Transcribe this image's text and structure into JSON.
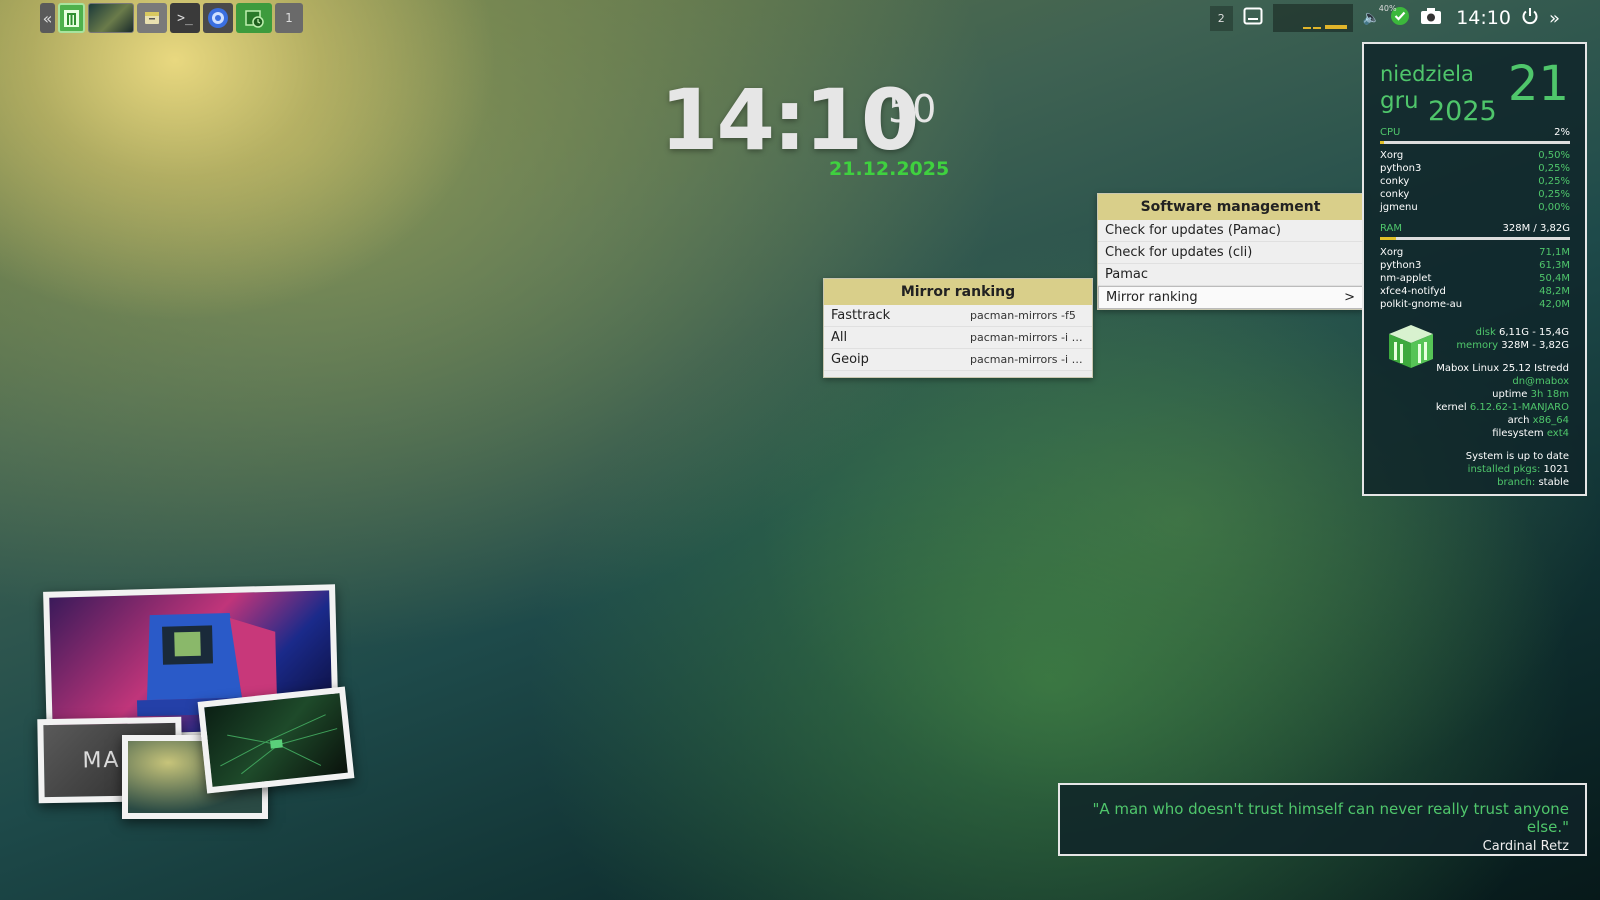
{
  "taskbar": {
    "workspace_num": "1"
  },
  "tray": {
    "workspace_count": "2",
    "volume_percent": "40%",
    "time": "14:10"
  },
  "clock": {
    "hours_minutes": "14:10",
    "seconds": "50",
    "date": "21.12.2025"
  },
  "software_menu": {
    "title": "Software management",
    "items": [
      {
        "label": "Check for updates (Pamac)"
      },
      {
        "label": "Check for updates (cli)"
      },
      {
        "label": "Pamac"
      },
      {
        "label": "Mirror ranking",
        "arrow": ">"
      }
    ]
  },
  "mirror_menu": {
    "title": "Mirror ranking",
    "items": [
      {
        "label": "Fasttrack",
        "cmd": "pacman-mirrors -f5"
      },
      {
        "label": "All",
        "cmd": "pacman-mirrors -i -c all"
      },
      {
        "label": "Geoip",
        "cmd": "pacman-mirrors -i --g…"
      }
    ]
  },
  "conky": {
    "day_name": "niedziela",
    "month": "gru",
    "year": "2025",
    "day_num": "21",
    "cpu_label": "CPU",
    "cpu_value": "2%",
    "cpu_fraction": 0.02,
    "cpu_procs": [
      {
        "name": "Xorg",
        "val": "0,50%"
      },
      {
        "name": "python3",
        "val": "0,25%"
      },
      {
        "name": "conky",
        "val": "0,25%"
      },
      {
        "name": "conky",
        "val": "0,25%"
      },
      {
        "name": "jgmenu",
        "val": "0,00%"
      }
    ],
    "ram_label": "RAM",
    "ram_value": "328M / 3,82G",
    "ram_fraction": 0.086,
    "ram_procs": [
      {
        "name": "Xorg",
        "val": "71,1M"
      },
      {
        "name": "python3",
        "val": "61,3M"
      },
      {
        "name": "nm-applet",
        "val": "50,4M"
      },
      {
        "name": "xfce4-notifyd",
        "val": "48,2M"
      },
      {
        "name": "polkit-gnome-au",
        "val": "42,0M"
      }
    ],
    "disk_label": "disk",
    "disk_value": "6,11G - 15,4G",
    "memory_label": "memory",
    "memory_value": "328M - 3,82G",
    "distro": "Mabox Linux 25.12 Istredd",
    "user": "dn@mabox",
    "uptime_label": "uptime",
    "uptime_value": "3h 18m",
    "kernel_label": "kernel",
    "kernel_value": "6.12.62-1-MANJARO",
    "arch_label": "arch",
    "arch_value": "x86_64",
    "fs_label": "filesystem",
    "fs_value": "ext4",
    "update_status": "System is up to date",
    "pkgs_label": "installed pkgs:",
    "pkgs_value": "1021",
    "branch_label": "branch:",
    "branch_value": "stable"
  },
  "quote": {
    "text": "\"A man who doesn't trust himself can never really trust anyone else.\"",
    "author": "Cardinal Retz"
  },
  "collage": {
    "mabox_text": "MAB"
  }
}
